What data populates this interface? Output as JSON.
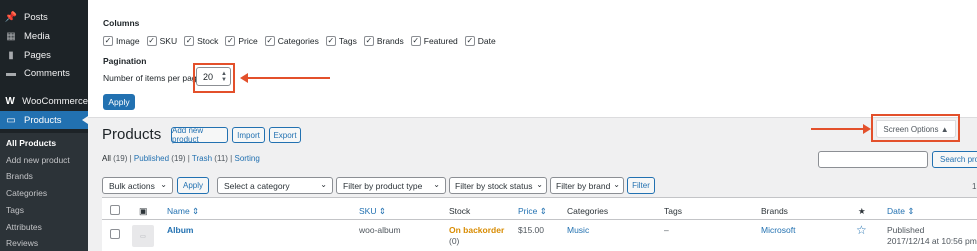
{
  "sidebar": {
    "items": [
      {
        "label": "Posts",
        "icon": "pin-icon"
      },
      {
        "label": "Media",
        "icon": "media-icon"
      },
      {
        "label": "Pages",
        "icon": "pages-icon"
      },
      {
        "label": "Comments",
        "icon": "comments-icon"
      },
      {
        "label": "WooCommerce",
        "icon": "woocommerce-icon"
      },
      {
        "label": "Products",
        "icon": "products-icon"
      }
    ],
    "submenu": [
      "All Products",
      "Add new product",
      "Brands",
      "Categories",
      "Tags",
      "Attributes",
      "Reviews"
    ]
  },
  "screen_options": {
    "columns_heading": "Columns",
    "columns": [
      {
        "label": "Image",
        "checked": true
      },
      {
        "label": "SKU",
        "checked": true
      },
      {
        "label": "Stock",
        "checked": true
      },
      {
        "label": "Price",
        "checked": true
      },
      {
        "label": "Categories",
        "checked": true
      },
      {
        "label": "Tags",
        "checked": true
      },
      {
        "label": "Brands",
        "checked": true
      },
      {
        "label": "Featured",
        "checked": true
      },
      {
        "label": "Date",
        "checked": true
      }
    ],
    "pagination_heading": "Pagination",
    "per_page_label": "Number of items per page:",
    "per_page_value": "20",
    "apply_label": "Apply",
    "tab_label": "Screen Options ▲"
  },
  "page": {
    "title": "Products",
    "add_new": "Add new product",
    "import": "Import",
    "export": "Export"
  },
  "views": {
    "all": "All",
    "all_count": "(19)",
    "published": "Published",
    "published_count": "(19)",
    "trash": "Trash",
    "trash_count": "(11)",
    "sorting": "Sorting",
    "sep": "|"
  },
  "search": {
    "button": "Search products"
  },
  "filters": {
    "bulk_actions": "Bulk actions",
    "apply": "Apply",
    "category": "Select a category",
    "product_type": "Filter by product type",
    "stock_status": "Filter by stock status",
    "brand": "Filter by brand",
    "filter_button": "Filter",
    "items_count": "1"
  },
  "table": {
    "headers": {
      "name": "Name ⇕",
      "sku": "SKU ⇕",
      "stock": "Stock",
      "price": "Price ⇕",
      "categories": "Categories",
      "tags": "Tags",
      "brands": "Brands",
      "featured": "★",
      "date": "Date ⇕"
    },
    "rows": [
      {
        "name": "Album",
        "sku": "woo-album",
        "stock_status": "On backorder",
        "stock_qty": "(0)",
        "price": "$15.00",
        "categories": "Music",
        "tags": "–",
        "brands": "Microsoft",
        "date_status": "Published",
        "date_value": "2017/12/14 at 10:56 pm"
      }
    ]
  },
  "colors": {
    "sidebar_bg": "#1d2327",
    "accent": "#2271b1",
    "highlight": "#e3502b",
    "backorder": "#d88b00"
  }
}
